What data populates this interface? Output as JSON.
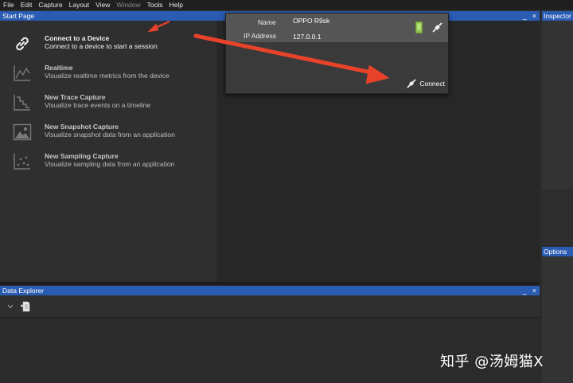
{
  "menu": [
    "File",
    "Edit",
    "Capture",
    "Layout",
    "View",
    "Window",
    "Tools",
    "Help"
  ],
  "menu_disabled": [
    "Window"
  ],
  "start_page": {
    "title": "Start Page",
    "items": [
      {
        "title": "Connect to a Device",
        "desc": "Connect to a device to start a session",
        "icon": "link-icon"
      },
      {
        "title": "Realtime",
        "desc": "Visualize realtime metrics from the device",
        "icon": "line-chart-icon"
      },
      {
        "title": "New Trace Capture",
        "desc": "Visualize trace events on a timeline",
        "icon": "trace-icon"
      },
      {
        "title": "New Snapshot Capture",
        "desc": "Visualize snapshot data from an application",
        "icon": "image-icon"
      },
      {
        "title": "New Sampling Capture",
        "desc": "Visualize sampling data from an application",
        "icon": "scatter-icon"
      }
    ]
  },
  "device": {
    "name_label": "Name",
    "name_value": "OPPO R9sk",
    "ip_label": "IP Address",
    "ip_value": "127.0.0.1",
    "connect_label": "Connect"
  },
  "inspector": {
    "title": "Inspector"
  },
  "options": {
    "title": "Options"
  },
  "data_explorer": {
    "title": "Data Explorer"
  },
  "window_controls": {
    "minimize": "_",
    "close": "×"
  },
  "watermark": "知乎 @汤姆猫X",
  "colors": {
    "title_bar": "#2b5cb3",
    "annotation_arrow": "#e8432a",
    "phone_icon": "#8cc04a"
  }
}
